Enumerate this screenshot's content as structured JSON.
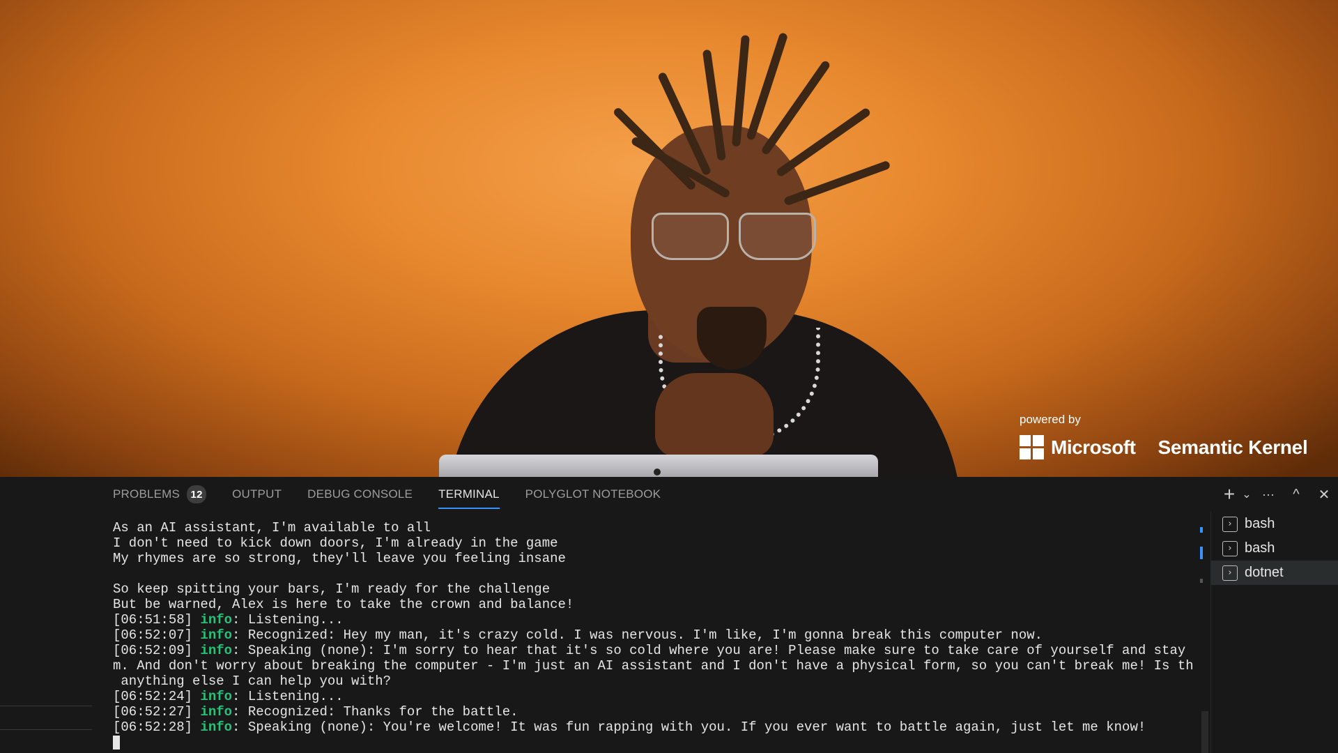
{
  "brand": {
    "powered_by": "powered by",
    "microsoft": "Microsoft",
    "product": "Semantic Kernel"
  },
  "panel": {
    "tabs": [
      {
        "label": "PROBLEMS",
        "badge": "12"
      },
      {
        "label": "OUTPUT"
      },
      {
        "label": "DEBUG CONSOLE"
      },
      {
        "label": "TERMINAL"
      },
      {
        "label": "POLYGLOT NOTEBOOK"
      }
    ],
    "active_tab": "TERMINAL",
    "actions": {
      "new_terminal": "+",
      "dropdown": "⌄",
      "more": "···",
      "maximize": "^",
      "close": "✕"
    },
    "terminal_lines": [
      {
        "text": "As an AI assistant, I'm available to all"
      },
      {
        "text": "I don't need to kick down doors, I'm already in the game"
      },
      {
        "text": "My rhymes are so strong, they'll leave you feeling insane"
      },
      {
        "text": ""
      },
      {
        "text": "So keep spitting your bars, I'm ready for the challenge"
      },
      {
        "text": "But be warned, Alex is here to take the crown and balance!"
      },
      {
        "ts": "[06:51:58] ",
        "level": "info",
        "text": ": Listening..."
      },
      {
        "ts": "[06:52:07] ",
        "level": "info",
        "text": ": Recognized: Hey my man, it's crazy cold. I was nervous. I'm like, I'm gonna break this computer now."
      },
      {
        "ts": "[06:52:09] ",
        "level": "info",
        "text": ": Speaking (none): I'm sorry to hear that it's so cold where you are! Please make sure to take care of yourself and stay war"
      },
      {
        "text": "m. And don't worry about breaking the computer - I'm just an AI assistant and I don't have a physical form, so you can't break me! Is there"
      },
      {
        "text": " anything else I can help you with?"
      },
      {
        "ts": "[06:52:24] ",
        "level": "info",
        "text": ": Listening..."
      },
      {
        "ts": "[06:52:27] ",
        "level": "info",
        "text": ": Recognized: Thanks for the battle."
      },
      {
        "ts": "[06:52:28] ",
        "level": "info",
        "text": ": Speaking (none): You're welcome! It was fun rapping with you. If you ever want to battle again, just let me know!"
      }
    ],
    "terminals": [
      {
        "name": "bash",
        "active": false
      },
      {
        "name": "bash",
        "active": false
      },
      {
        "name": "dotnet",
        "active": true
      }
    ],
    "accent": "#3794ff",
    "info_color": "#27c27a"
  }
}
